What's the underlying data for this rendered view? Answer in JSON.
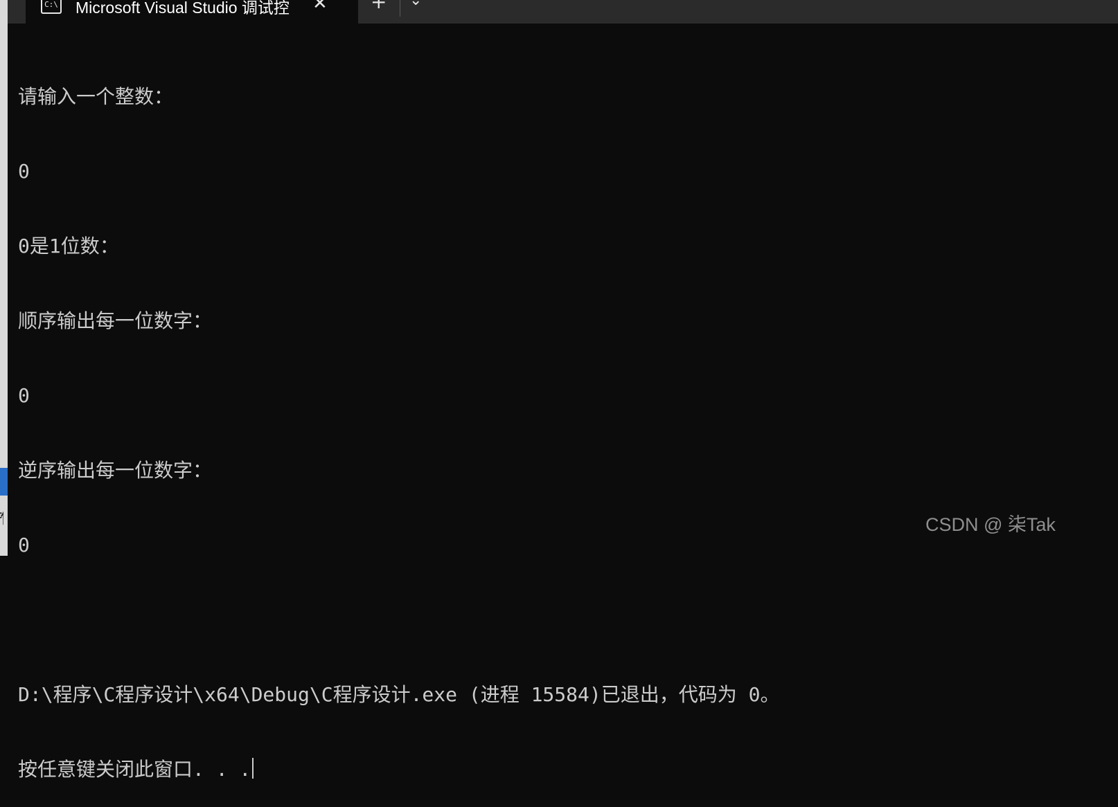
{
  "window": {
    "tab_icon_text": "C:\\",
    "tab_title": "Microsoft Visual Studio 调试控",
    "close_glyph": "✕",
    "new_tab_glyph": "+",
    "dropdown_glyph": "⌄",
    "icons": [
      "terminal-icon",
      "close-icon",
      "plus-icon",
      "chevron-down-icon"
    ]
  },
  "console": {
    "lines": [
      "请输入一个整数：",
      "0",
      "0是1位数：",
      "顺序输出每一位数字：",
      "0",
      "逆序输出每一位数字：",
      "0",
      "",
      "D:\\程序\\C程序设计\\x64\\Debug\\C程序设计.exe (进程 15584)已退出，代码为 0。",
      "按任意键关闭此窗口. . ."
    ]
  },
  "watermark": "CSDN @ 柒Tak",
  "colors": {
    "background": "#0c0c0c",
    "text": "#cccccc",
    "titlebar": "#2b2b2b"
  }
}
